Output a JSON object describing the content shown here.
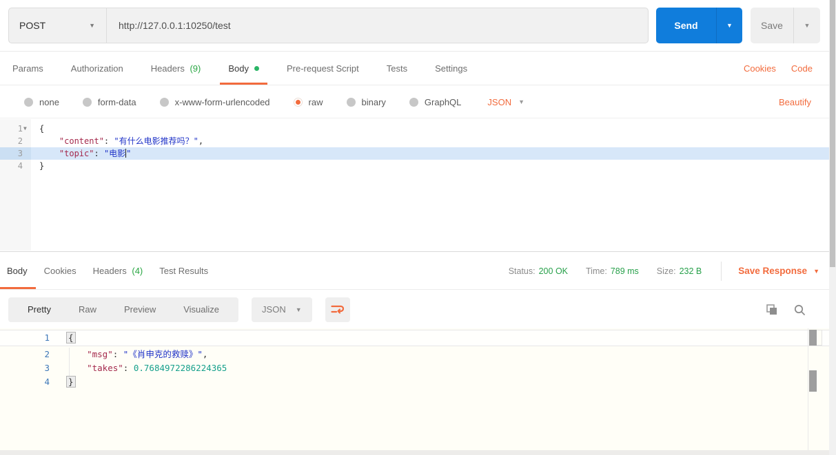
{
  "colors": {
    "accent_orange": "#f26b3d",
    "send_blue": "#107ddc",
    "success_green": "#29a643",
    "json_key": "#a4294c",
    "json_string": "#2134c8",
    "json_number": "#16a08c",
    "response_line_number": "#3d77b8"
  },
  "request_bar": {
    "method": "POST",
    "url": "http://127.0.0.1:10250/test",
    "send_label": "Send",
    "save_label": "Save"
  },
  "request_tabs": {
    "items": [
      {
        "label": "Params"
      },
      {
        "label": "Authorization"
      },
      {
        "label": "Headers",
        "count": "(9)"
      },
      {
        "label": "Body"
      },
      {
        "label": "Pre-request Script"
      },
      {
        "label": "Tests"
      },
      {
        "label": "Settings"
      }
    ],
    "active": "Body",
    "cookies_link": "Cookies",
    "code_link": "Code"
  },
  "body_type_bar": {
    "options": [
      "none",
      "form-data",
      "x-www-form-urlencoded",
      "raw",
      "binary",
      "GraphQL"
    ],
    "selected": "raw",
    "format_label": "JSON",
    "beautify_label": "Beautify"
  },
  "req_code": {
    "l1_num": "1",
    "l1_text": "{",
    "l2_num": "2",
    "l2_key": "    \"content\"",
    "l2_colon": ": ",
    "l2_value": "\"有什么电影推荐吗？\"",
    "l2_comma": ",",
    "l3_num": "3",
    "l3_key": "    \"topic\"",
    "l3_colon": ": ",
    "l3_value_open": "\"电影",
    "l3_value_close": "\"",
    "l4_num": "4",
    "l4_text": "}"
  },
  "response_meta": {
    "tabs": [
      {
        "label": "Body"
      },
      {
        "label": "Cookies"
      },
      {
        "label": "Headers",
        "count": "(4)"
      },
      {
        "label": "Test Results"
      }
    ],
    "active": "Body",
    "status_label": "Status:",
    "status_value": "200 OK",
    "time_label": "Time:",
    "time_value": "789 ms",
    "size_label": "Size:",
    "size_value": "232 B",
    "save_response_label": "Save Response"
  },
  "response_toolbar": {
    "views": [
      "Pretty",
      "Raw",
      "Preview",
      "Visualize"
    ],
    "active_view": "Pretty",
    "format_label": "JSON"
  },
  "resp_code": {
    "l1_num": "1",
    "l1_text": "{",
    "l2_num": "2",
    "l2_key": "    \"msg\"",
    "l2_colon": ": ",
    "l2_value": "\"《肖申克的救赎》\"",
    "l2_comma": ",",
    "l3_num": "3",
    "l3_key": "    \"takes\"",
    "l3_colon": ": ",
    "l3_value": "0.7684972286224365",
    "l4_num": "4",
    "l4_text": "}"
  }
}
